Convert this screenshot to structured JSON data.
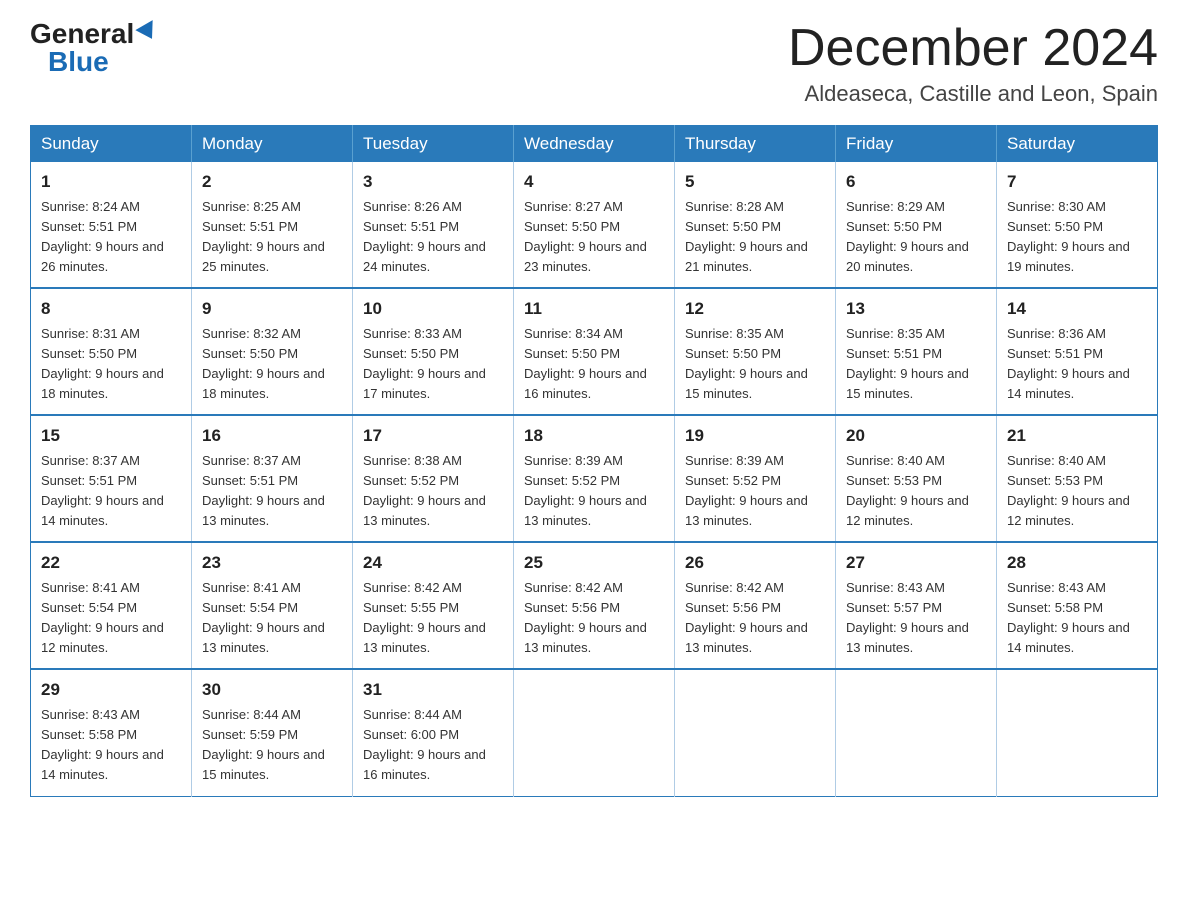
{
  "logo": {
    "general": "General",
    "blue": "Blue"
  },
  "title": {
    "month": "December 2024",
    "location": "Aldeaseca, Castille and Leon, Spain"
  },
  "days_of_week": [
    "Sunday",
    "Monday",
    "Tuesday",
    "Wednesday",
    "Thursday",
    "Friday",
    "Saturday"
  ],
  "weeks": [
    [
      {
        "day": "1",
        "sunrise": "Sunrise: 8:24 AM",
        "sunset": "Sunset: 5:51 PM",
        "daylight": "Daylight: 9 hours and 26 minutes."
      },
      {
        "day": "2",
        "sunrise": "Sunrise: 8:25 AM",
        "sunset": "Sunset: 5:51 PM",
        "daylight": "Daylight: 9 hours and 25 minutes."
      },
      {
        "day": "3",
        "sunrise": "Sunrise: 8:26 AM",
        "sunset": "Sunset: 5:51 PM",
        "daylight": "Daylight: 9 hours and 24 minutes."
      },
      {
        "day": "4",
        "sunrise": "Sunrise: 8:27 AM",
        "sunset": "Sunset: 5:50 PM",
        "daylight": "Daylight: 9 hours and 23 minutes."
      },
      {
        "day": "5",
        "sunrise": "Sunrise: 8:28 AM",
        "sunset": "Sunset: 5:50 PM",
        "daylight": "Daylight: 9 hours and 21 minutes."
      },
      {
        "day": "6",
        "sunrise": "Sunrise: 8:29 AM",
        "sunset": "Sunset: 5:50 PM",
        "daylight": "Daylight: 9 hours and 20 minutes."
      },
      {
        "day": "7",
        "sunrise": "Sunrise: 8:30 AM",
        "sunset": "Sunset: 5:50 PM",
        "daylight": "Daylight: 9 hours and 19 minutes."
      }
    ],
    [
      {
        "day": "8",
        "sunrise": "Sunrise: 8:31 AM",
        "sunset": "Sunset: 5:50 PM",
        "daylight": "Daylight: 9 hours and 18 minutes."
      },
      {
        "day": "9",
        "sunrise": "Sunrise: 8:32 AM",
        "sunset": "Sunset: 5:50 PM",
        "daylight": "Daylight: 9 hours and 18 minutes."
      },
      {
        "day": "10",
        "sunrise": "Sunrise: 8:33 AM",
        "sunset": "Sunset: 5:50 PM",
        "daylight": "Daylight: 9 hours and 17 minutes."
      },
      {
        "day": "11",
        "sunrise": "Sunrise: 8:34 AM",
        "sunset": "Sunset: 5:50 PM",
        "daylight": "Daylight: 9 hours and 16 minutes."
      },
      {
        "day": "12",
        "sunrise": "Sunrise: 8:35 AM",
        "sunset": "Sunset: 5:50 PM",
        "daylight": "Daylight: 9 hours and 15 minutes."
      },
      {
        "day": "13",
        "sunrise": "Sunrise: 8:35 AM",
        "sunset": "Sunset: 5:51 PM",
        "daylight": "Daylight: 9 hours and 15 minutes."
      },
      {
        "day": "14",
        "sunrise": "Sunrise: 8:36 AM",
        "sunset": "Sunset: 5:51 PM",
        "daylight": "Daylight: 9 hours and 14 minutes."
      }
    ],
    [
      {
        "day": "15",
        "sunrise": "Sunrise: 8:37 AM",
        "sunset": "Sunset: 5:51 PM",
        "daylight": "Daylight: 9 hours and 14 minutes."
      },
      {
        "day": "16",
        "sunrise": "Sunrise: 8:37 AM",
        "sunset": "Sunset: 5:51 PM",
        "daylight": "Daylight: 9 hours and 13 minutes."
      },
      {
        "day": "17",
        "sunrise": "Sunrise: 8:38 AM",
        "sunset": "Sunset: 5:52 PM",
        "daylight": "Daylight: 9 hours and 13 minutes."
      },
      {
        "day": "18",
        "sunrise": "Sunrise: 8:39 AM",
        "sunset": "Sunset: 5:52 PM",
        "daylight": "Daylight: 9 hours and 13 minutes."
      },
      {
        "day": "19",
        "sunrise": "Sunrise: 8:39 AM",
        "sunset": "Sunset: 5:52 PM",
        "daylight": "Daylight: 9 hours and 13 minutes."
      },
      {
        "day": "20",
        "sunrise": "Sunrise: 8:40 AM",
        "sunset": "Sunset: 5:53 PM",
        "daylight": "Daylight: 9 hours and 12 minutes."
      },
      {
        "day": "21",
        "sunrise": "Sunrise: 8:40 AM",
        "sunset": "Sunset: 5:53 PM",
        "daylight": "Daylight: 9 hours and 12 minutes."
      }
    ],
    [
      {
        "day": "22",
        "sunrise": "Sunrise: 8:41 AM",
        "sunset": "Sunset: 5:54 PM",
        "daylight": "Daylight: 9 hours and 12 minutes."
      },
      {
        "day": "23",
        "sunrise": "Sunrise: 8:41 AM",
        "sunset": "Sunset: 5:54 PM",
        "daylight": "Daylight: 9 hours and 13 minutes."
      },
      {
        "day": "24",
        "sunrise": "Sunrise: 8:42 AM",
        "sunset": "Sunset: 5:55 PM",
        "daylight": "Daylight: 9 hours and 13 minutes."
      },
      {
        "day": "25",
        "sunrise": "Sunrise: 8:42 AM",
        "sunset": "Sunset: 5:56 PM",
        "daylight": "Daylight: 9 hours and 13 minutes."
      },
      {
        "day": "26",
        "sunrise": "Sunrise: 8:42 AM",
        "sunset": "Sunset: 5:56 PM",
        "daylight": "Daylight: 9 hours and 13 minutes."
      },
      {
        "day": "27",
        "sunrise": "Sunrise: 8:43 AM",
        "sunset": "Sunset: 5:57 PM",
        "daylight": "Daylight: 9 hours and 13 minutes."
      },
      {
        "day": "28",
        "sunrise": "Sunrise: 8:43 AM",
        "sunset": "Sunset: 5:58 PM",
        "daylight": "Daylight: 9 hours and 14 minutes."
      }
    ],
    [
      {
        "day": "29",
        "sunrise": "Sunrise: 8:43 AM",
        "sunset": "Sunset: 5:58 PM",
        "daylight": "Daylight: 9 hours and 14 minutes."
      },
      {
        "day": "30",
        "sunrise": "Sunrise: 8:44 AM",
        "sunset": "Sunset: 5:59 PM",
        "daylight": "Daylight: 9 hours and 15 minutes."
      },
      {
        "day": "31",
        "sunrise": "Sunrise: 8:44 AM",
        "sunset": "Sunset: 6:00 PM",
        "daylight": "Daylight: 9 hours and 16 minutes."
      },
      null,
      null,
      null,
      null
    ]
  ]
}
